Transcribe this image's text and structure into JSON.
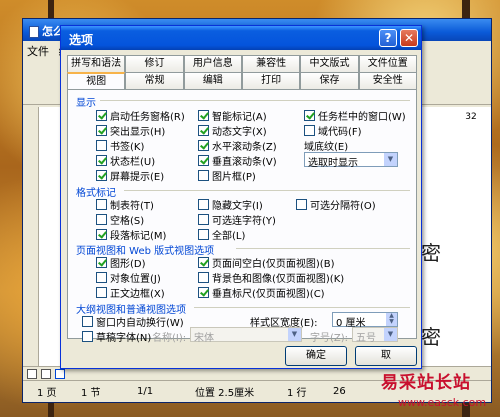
{
  "word": {
    "title": "怎么",
    "menu": [
      "文件",
      "编"
    ],
    "ruler_number": "32",
    "doc_text_1": "密",
    "doc_text_2": "密",
    "status": {
      "page": "1 页",
      "section": "1 节",
      "page_of": "1/1",
      "position": "位置 2.5厘米",
      "line": "1 行",
      "col": "26"
    }
  },
  "dialog": {
    "title": "选项",
    "help_label": "?",
    "close_label": "✕",
    "tabs_row1": [
      "拼写和语法",
      "修订",
      "用户信息",
      "兼容性",
      "中文版式",
      "文件位置"
    ],
    "tabs_row2": [
      "视图",
      "常规",
      "编辑",
      "打印",
      "保存",
      "安全性"
    ],
    "active_tab": "视图",
    "sections": {
      "show": {
        "title": "显示",
        "options": [
          {
            "label": "启动任务窗格(R)",
            "checked": true
          },
          {
            "label": "智能标记(A)",
            "checked": true
          },
          {
            "label": "任务栏中的窗口(W)",
            "checked": true
          },
          {
            "label": "突出显示(H)",
            "checked": true
          },
          {
            "label": "动态文字(X)",
            "checked": true
          },
          {
            "label": "域代码(F)",
            "checked": false
          },
          {
            "label": "书签(K)",
            "checked": false
          },
          {
            "label": "水平滚动条(Z)",
            "checked": true
          },
          {
            "label": "状态栏(U)",
            "checked": true
          },
          {
            "label": "垂直滚动条(V)",
            "checked": true
          },
          {
            "label": "屏幕提示(E)",
            "checked": true
          },
          {
            "label": "图片框(P)",
            "checked": false
          }
        ],
        "field_shading_label": "域底纹(E)",
        "field_shading_value": "选取时显示"
      },
      "format_marks": {
        "title": "格式标记",
        "options": [
          {
            "label": "制表符(T)",
            "checked": false
          },
          {
            "label": "隐藏文字(I)",
            "checked": false
          },
          {
            "label": "可选分隔符(O)",
            "checked": false
          },
          {
            "label": "空格(S)",
            "checked": false
          },
          {
            "label": "可选连字符(Y)",
            "checked": false
          },
          {
            "label": "段落标记(M)",
            "checked": true
          },
          {
            "label": "全部(L)",
            "checked": false
          }
        ]
      },
      "page_view": {
        "title": "页面视图和 Web 版式视图选项",
        "options": [
          {
            "label": "图形(D)",
            "checked": true
          },
          {
            "label": "页面间空白(仅页面视图)(B)",
            "checked": true
          },
          {
            "label": "对象位置(J)",
            "checked": false
          },
          {
            "label": "背景色和图像(仅页面视图)(K)",
            "checked": false
          },
          {
            "label": "正文边框(X)",
            "checked": false
          },
          {
            "label": "垂直标尺(仅页面视图)(C)",
            "checked": true
          }
        ]
      },
      "outline": {
        "title": "大纲视图和普通视图选项",
        "wrap": {
          "label": "窗口内自动换行(W)",
          "checked": false
        },
        "style_width_label": "样式区宽度(E):",
        "style_width_value": "0 厘米",
        "draft": {
          "label": "草稿字体(N)",
          "checked": false
        },
        "font_name_label": "名称(I):",
        "font_name_value": "宋体",
        "font_size_label": "字号(Z):",
        "font_size_value": "五号"
      }
    },
    "ok_label": "确定",
    "cancel_label": "取"
  },
  "watermark": {
    "cn": "易采站长站",
    "en": "www.easck.com"
  }
}
